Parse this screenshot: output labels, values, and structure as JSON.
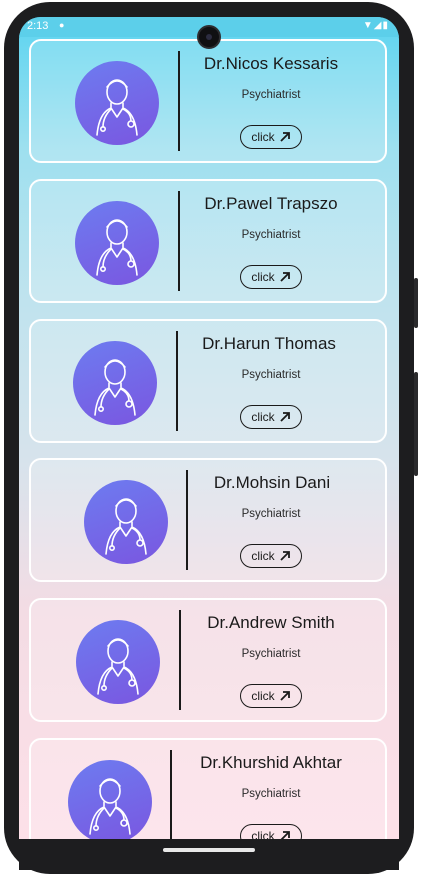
{
  "status_bar": {
    "time": "2:13",
    "notification_icon": "download-dot-icon",
    "right_icons": "▼◢▮"
  },
  "doctors": [
    {
      "name": "Dr.Nicos Kessaris",
      "specialty": "Psychiatrist",
      "action_label": "click"
    },
    {
      "name": "Dr.Pawel Trapszo",
      "specialty": "Psychiatrist",
      "action_label": "click"
    },
    {
      "name": "Dr.Harun Thomas",
      "specialty": "Psychiatrist",
      "action_label": "click"
    },
    {
      "name": "Dr.Mohsin Dani",
      "specialty": "Psychiatrist",
      "action_label": "click"
    },
    {
      "name": "Dr.Andrew Smith",
      "specialty": "Psychiatrist",
      "action_label": "click"
    },
    {
      "name": "Dr.Khurshid Akhtar",
      "specialty": "Psychiatrist",
      "action_label": "click"
    }
  ],
  "colors": {
    "avatar_top": "#6d7cf0",
    "avatar_bottom": "#7a56e0",
    "status_bar": "#5ccfea"
  }
}
